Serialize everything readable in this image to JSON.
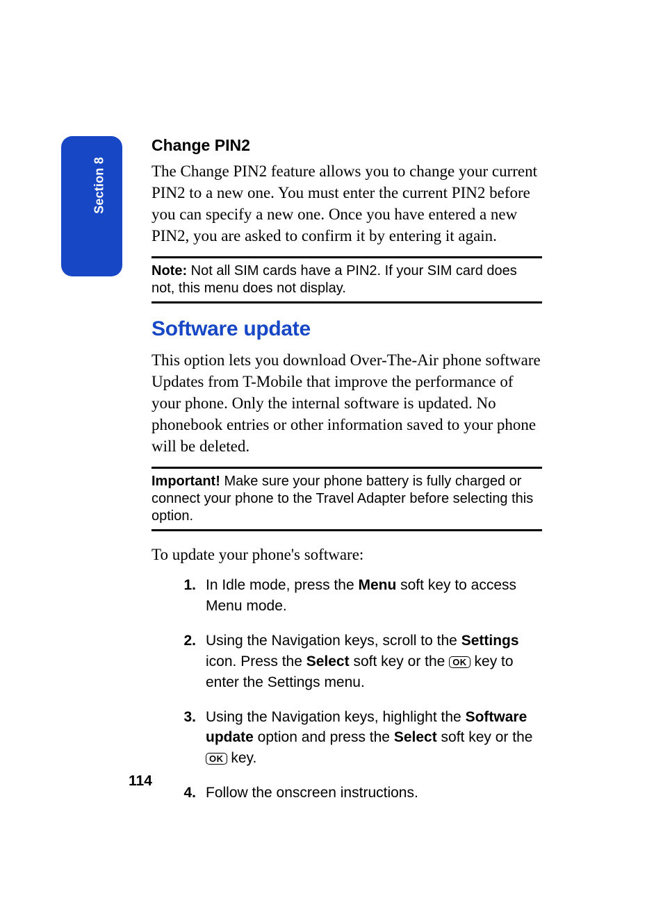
{
  "sectionTab": "Section 8",
  "pageNumber": "114",
  "changePin2": {
    "heading": "Change PIN2",
    "body": "The Change PIN2 feature allows you to change your current PIN2 to a new one. You must enter the current PIN2 before you can specify a new one. Once you have entered a new PIN2, you are asked to confirm it by entering it again."
  },
  "noteCallout": {
    "lead": "Note:",
    "text": " Not all SIM cards have a PIN2. If your SIM card does not, this menu does not display."
  },
  "softwareUpdate": {
    "heading": "Software update",
    "body": "This option lets you download Over-The-Air phone software Updates from T-Mobile that improve the performance of your phone. Only the internal software is updated. No phonebook entries or other information saved to your phone will be deleted."
  },
  "importantCallout": {
    "lead": "Important!",
    "text": " Make sure your phone battery is fully charged or connect your phone to the Travel Adapter before selecting this option."
  },
  "stepsIntro": "To update your phone's software:",
  "steps": {
    "s1": {
      "num": "1.",
      "pre": "In Idle mode, press the ",
      "b1": "Menu",
      "post": " soft key to access Menu mode."
    },
    "s2": {
      "num": "2.",
      "pre": "Using the Navigation keys, scroll to the ",
      "b1": "Settings",
      "mid1": " icon. Press the ",
      "b2": "Select",
      "mid2": " soft key or the ",
      "ok": "OK",
      "post": " key to enter the Settings menu."
    },
    "s3": {
      "num": "3.",
      "pre": "Using the Navigation keys, highlight the ",
      "b1": "Software update",
      "mid1": " option and press the ",
      "b2": "Select",
      "mid2": " soft key or the ",
      "ok": "OK",
      "post": " key."
    },
    "s4": {
      "num": "4.",
      "text": "Follow the onscreen instructions."
    }
  }
}
